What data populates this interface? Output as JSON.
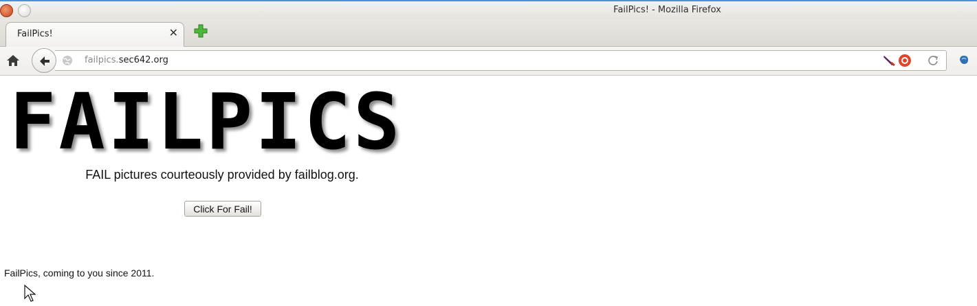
{
  "window": {
    "title": "FailPics! - Mozilla Firefox"
  },
  "tabs": [
    {
      "label": "FailPics!",
      "close_icon": "close-icon",
      "active": true
    }
  ],
  "toolbar": {
    "home_icon": "home-icon",
    "back_icon": "back-arrow-icon",
    "url_prefix": "failpics.",
    "url_domain": "sec642.org",
    "reload_icon": "reload-icon",
    "extension_icons": [
      "feather-extension-icon",
      "lifebuoy-extension-icon",
      "addon-icon"
    ]
  },
  "page": {
    "logo": "FAILPICS",
    "tagline": "FAIL pictures courteously provided by failblog.org.",
    "button_label": "Click For Fail!",
    "footer": "FailPics, coming to you since 2011."
  },
  "colors": {
    "accent_blue": "#4a90d9",
    "new_tab_green": "#3aa52a",
    "extension_red": "#e0452b"
  }
}
